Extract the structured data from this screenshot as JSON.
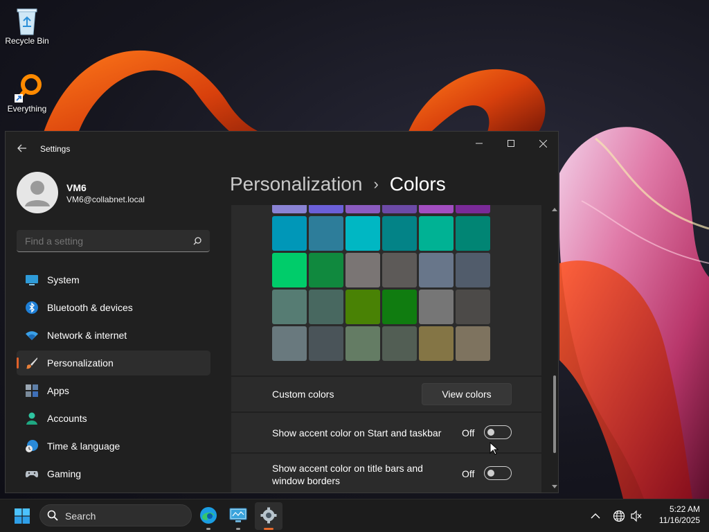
{
  "desktop": {
    "icons": [
      {
        "label": "Recycle Bin"
      },
      {
        "label": "Everything"
      }
    ]
  },
  "window": {
    "title": "Settings",
    "user": {
      "name": "VM6",
      "email": "VM6@collabnet.local"
    },
    "search": {
      "placeholder": "Find a setting"
    },
    "nav": [
      {
        "label": "System",
        "icon": "monitor-icon"
      },
      {
        "label": "Bluetooth & devices",
        "icon": "bluetooth-icon"
      },
      {
        "label": "Network & internet",
        "icon": "wifi-icon"
      },
      {
        "label": "Personalization",
        "icon": "paintbrush-icon",
        "selected": true
      },
      {
        "label": "Apps",
        "icon": "apps-icon"
      },
      {
        "label": "Accounts",
        "icon": "person-icon"
      },
      {
        "label": "Time & language",
        "icon": "clock-globe-icon"
      },
      {
        "label": "Gaming",
        "icon": "gamepad-icon"
      }
    ],
    "breadcrumb": {
      "parent": "Personalization",
      "separator": "›",
      "current": "Colors"
    },
    "palette": {
      "top_row": [
        "#8a83d4",
        "#6b5fd8",
        "#8a5bbf",
        "#6c4aa6",
        "#a24ec0",
        "#7a2a98"
      ],
      "rows": [
        [
          "#0097b8",
          "#2d7d9a",
          "#00b7c3",
          "#038387",
          "#00b294",
          "#018574"
        ],
        [
          "#00cc6a",
          "#10893e",
          "#7a7574",
          "#5d5a58",
          "#68768a",
          "#515c6b"
        ],
        [
          "#567c73",
          "#486860",
          "#498205",
          "#107c10",
          "#767676",
          "#4c4a48"
        ],
        [
          "#69797e",
          "#4a5459",
          "#647c64",
          "#525e54",
          "#847545",
          "#7e735f"
        ]
      ]
    },
    "custom_colors": {
      "label": "Custom colors",
      "button": "View colors"
    },
    "settings": [
      {
        "label": "Show accent color on Start and taskbar",
        "state": "Off"
      },
      {
        "label": "Show accent color on title bars and window borders",
        "state": "Off"
      }
    ]
  },
  "taskbar": {
    "search_label": "Search",
    "time": "5:22 AM",
    "date": "11/16/2025"
  }
}
